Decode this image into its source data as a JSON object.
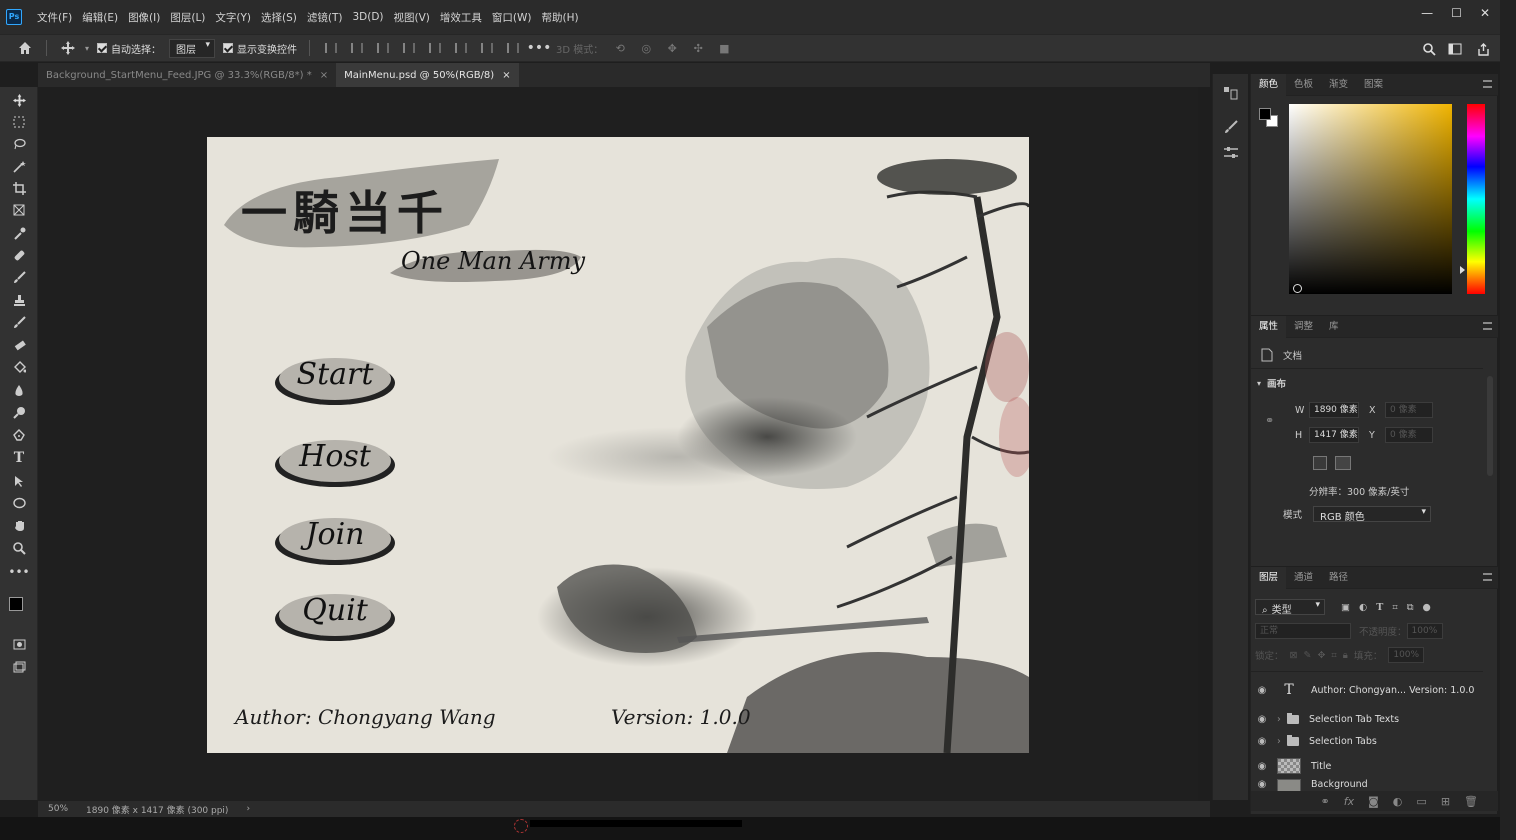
{
  "app": {
    "logo": "Ps"
  },
  "menu": [
    "文件(F)",
    "编辑(E)",
    "图像(I)",
    "图层(L)",
    "文字(Y)",
    "选择(S)",
    "滤镜(T)",
    "3D(D)",
    "视图(V)",
    "增效工具",
    "窗口(W)",
    "帮助(H)"
  ],
  "options_bar": {
    "auto_select_label": "自动选择：",
    "auto_select_value": "图层",
    "show_transform_label": "显示变换控件",
    "mode_3d_label": "3D 模式："
  },
  "tabs": [
    {
      "label": "Background_StartMenu_Feed.JPG @ 33.3%(RGB/8*) *",
      "active": false
    },
    {
      "label": "MainMenu.psd @ 50%(RGB/8)",
      "active": true
    }
  ],
  "canvas": {
    "title_cn": "一騎当千",
    "title_en": "One Man Army",
    "buttons": [
      "Start",
      "Host",
      "Join",
      "Quit"
    ],
    "author": "Author: Chongyang Wang",
    "version": "Version: 1.0.0"
  },
  "status": {
    "zoom": "50%",
    "doc_size": "1890 像素 x 1417 像素 (300 ppi)"
  },
  "color_panel": {
    "tabs": [
      "颜色",
      "色板",
      "渐变",
      "图案"
    ],
    "active_tab": 0
  },
  "properties_panel": {
    "tabs": [
      "属性",
      "调整",
      "库"
    ],
    "doc_label": "文档",
    "section": "画布",
    "w_label": "W",
    "w_value": "1890 像素",
    "h_label": "H",
    "h_value": "1417 像素",
    "x_label": "X",
    "x_value": "0 像素",
    "y_label": "Y",
    "y_value": "0 像素",
    "resolution": "分辨率：300 像素/英寸",
    "mode_label": "模式",
    "mode_value": "RGB 颜色"
  },
  "layers_panel": {
    "tabs": [
      "图层",
      "通道",
      "路径"
    ],
    "filter_value": "类型",
    "blend_value": "正常",
    "opacity_label": "不透明度：",
    "opacity_value": "100%",
    "lock_label": "锁定：",
    "fill_label": "填充：",
    "fill_value": "100%",
    "layers": [
      {
        "name": "Author: Chongyan... Version: 1.0.0",
        "kind": "text"
      },
      {
        "name": "Selection Tab Texts",
        "kind": "group"
      },
      {
        "name": "Selection Tabs",
        "kind": "group"
      },
      {
        "name": "Title",
        "kind": "image"
      },
      {
        "name": "Background",
        "kind": "image"
      }
    ]
  },
  "colors": {
    "accent": "#31a8ff",
    "panel_bg": "#2c2c2c",
    "canvas_bg": "#e6e3da",
    "ink": "#1c1c1c"
  }
}
